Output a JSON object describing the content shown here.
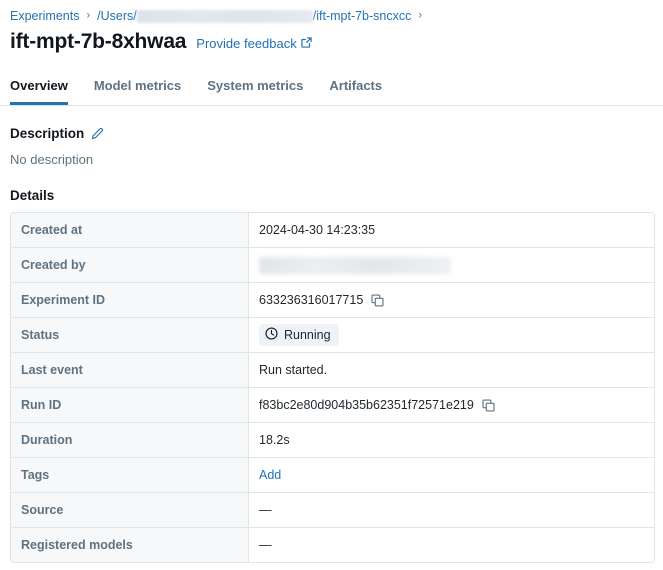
{
  "breadcrumb": {
    "root_label": "Experiments",
    "separator": "›",
    "path_prefix": "/Users/",
    "path_redacted": true,
    "path_suffix": "/ift-mpt-7b-sncxcc",
    "trailing_separator": "›"
  },
  "header": {
    "title": "ift-mpt-7b-8xhwaa",
    "feedback_label": "Provide feedback",
    "feedback_icon": "external-link-icon"
  },
  "tabs": [
    {
      "label": "Overview",
      "active": true
    },
    {
      "label": "Model metrics",
      "active": false
    },
    {
      "label": "System metrics",
      "active": false
    },
    {
      "label": "Artifacts",
      "active": false
    }
  ],
  "description": {
    "heading": "Description",
    "edit_icon": "pencil-icon",
    "body": "No description"
  },
  "details": {
    "heading": "Details",
    "rows": [
      {
        "label": "Created at",
        "value": "2024-04-30 14:23:35",
        "kind": "text"
      },
      {
        "label": "Created by",
        "value": "",
        "kind": "redacted"
      },
      {
        "label": "Experiment ID",
        "value": "633236316017715",
        "kind": "copyable"
      },
      {
        "label": "Status",
        "value": "Running",
        "kind": "badge",
        "icon": "clock-icon"
      },
      {
        "label": "Last event",
        "value": "Run started.",
        "kind": "text"
      },
      {
        "label": "Run ID",
        "value": "f83bc2e80d904b35b62351f72571e219",
        "kind": "copyable"
      },
      {
        "label": "Duration",
        "value": "18.2s",
        "kind": "text"
      },
      {
        "label": "Tags",
        "value": "Add",
        "kind": "link"
      },
      {
        "label": "Source",
        "value": "—",
        "kind": "text"
      },
      {
        "label": "Registered models",
        "value": "—",
        "kind": "text"
      }
    ]
  },
  "colors": {
    "accent": "#2272b4",
    "label_text": "#5f7281",
    "border": "#e0e5ea",
    "label_bg": "#f7f8f9",
    "badge_bg": "#eef3f9"
  }
}
